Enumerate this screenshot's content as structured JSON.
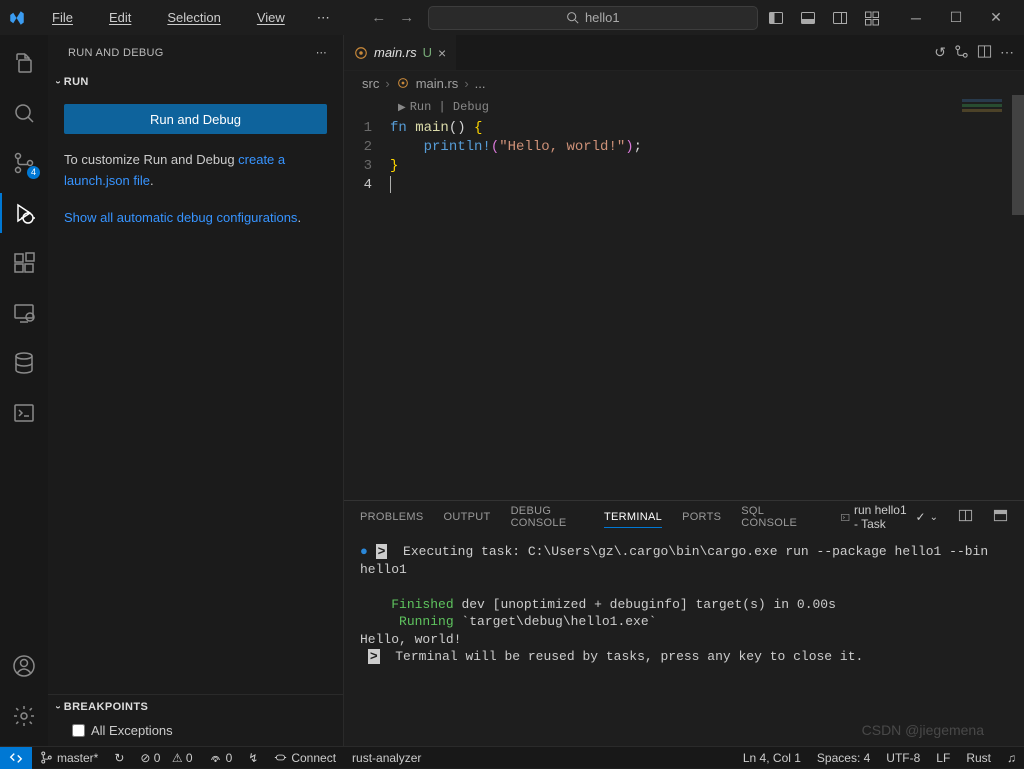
{
  "menus": {
    "file": "File",
    "edit": "Edit",
    "selection": "Selection",
    "view": "View",
    "more": "⋯"
  },
  "search": {
    "value": "hello1"
  },
  "sidebar": {
    "title": "RUN AND DEBUG",
    "section": "RUN",
    "button": "Run and Debug",
    "hint_prefix": "To customize Run and Debug ",
    "hint_link": "create a launch.json file",
    "hint_suffix": ".",
    "show_all": "Show all automatic debug configurations",
    "show_all_suffix": ".",
    "breakpoints_title": "BREAKPOINTS",
    "bp_item": "All Exceptions",
    "scm_badge": "4"
  },
  "tabs": {
    "file_icon": "rust",
    "filename": "main.rs",
    "status": "U"
  },
  "breadcrumb": {
    "src": "src",
    "file": "main.rs",
    "sep": "›",
    "tail": "..."
  },
  "codelens": "Run | Debug",
  "code": {
    "l1_kw": "fn ",
    "l1_fn": "main",
    "l1_rest": "() ",
    "l1_brace": "{",
    "l2_indent": "    ",
    "l2_mac": "println!",
    "l2_lp": "(",
    "l2_str": "\"Hello, world!\"",
    "l2_rp": ")",
    "l2_semi": ";",
    "l3": "}",
    "ln1": "1",
    "ln2": "2",
    "ln3": "3",
    "ln4": "4"
  },
  "panel": {
    "tabs": {
      "problems": "PROBLEMS",
      "output": "OUTPUT",
      "debug": "DEBUG CONSOLE",
      "terminal": "TERMINAL",
      "ports": "PORTS",
      "sql": "SQL CONSOLE"
    },
    "task_label": "run hello1 - Task"
  },
  "terminal": {
    "exec_prefix": "Executing task: ",
    "exec_cmd": "C:\\Users\\gz\\.cargo\\bin\\cargo.exe run --package hello1 --bin hello1",
    "finished_kw": "Finished",
    "finished_rest": " dev [unoptimized + debuginfo] target(s) in 0.00s",
    "running_kw": "Running",
    "running_rest": " `target\\debug\\hello1.exe`",
    "hello": "Hello, world!",
    "reuse": "Terminal will be reused by tasks, press any key to close it."
  },
  "status": {
    "branch": "master*",
    "sync": "↻",
    "errors": "⊘ 0",
    "warnings": "⚠ 0",
    "port": "0",
    "live": "↯",
    "connect": "Connect",
    "lsp": "rust-analyzer",
    "lncol": "Ln 4, Col 1",
    "spaces": "Spaces: 4",
    "enc": "UTF-8",
    "eol": "LF",
    "lang": "Rust",
    "bell": "♫"
  },
  "watermark": "CSDN @jiegemena"
}
